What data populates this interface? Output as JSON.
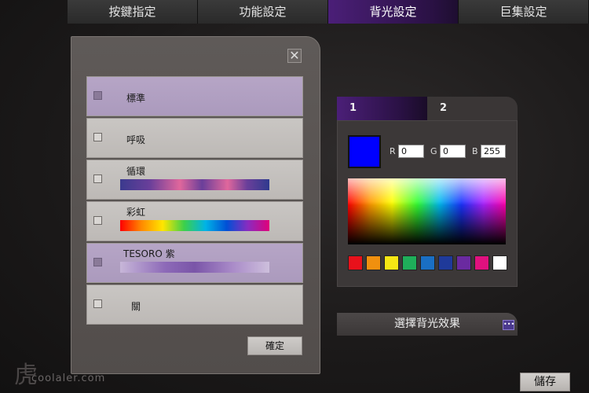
{
  "top_tabs": [
    {
      "label": "按鍵指定"
    },
    {
      "label": "功能設定"
    },
    {
      "label": "背光設定",
      "active": true
    },
    {
      "label": "巨集設定"
    }
  ],
  "dialog": {
    "close_glyph": "✕",
    "modes": [
      {
        "label": "標準",
        "selected": true
      },
      {
        "label": "呼吸",
        "selected": false
      },
      {
        "label": "循環",
        "selected": false
      },
      {
        "label": "彩虹",
        "selected": false
      },
      {
        "label": "TESORO 紫",
        "selected": true
      },
      {
        "label": "關",
        "selected": false
      }
    ],
    "confirm_label": "確定"
  },
  "color_panel": {
    "tabs": [
      {
        "label": "1"
      },
      {
        "label": "2"
      }
    ],
    "current_color": "#0000ff",
    "r_label": "R",
    "g_label": "G",
    "b_label": "B",
    "r_value": "0",
    "g_value": "0",
    "b_value": "255",
    "palette": [
      "#e8111b",
      "#f0900f",
      "#f5e614",
      "#1fae5a",
      "#1a6fc4",
      "#1f3a9a",
      "#6a2aa0",
      "#e0117f",
      "#ffffff"
    ]
  },
  "effect_button_label": "選擇背光效果",
  "save_label": "儲存",
  "watermark": "coolaler.com"
}
